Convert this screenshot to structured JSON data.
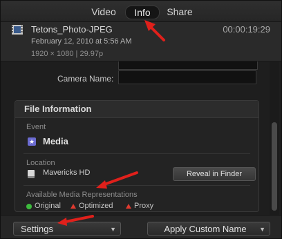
{
  "tabs": {
    "video": "Video",
    "info": "Info",
    "share": "Share"
  },
  "clip": {
    "name": "Tetons_Photo-JPEG",
    "duration": "00:00:19:29",
    "date": "February 12, 2010 at 5:56 AM",
    "format": "1920 × 1080  |  29.97p"
  },
  "metadata": {
    "camera_name_label": "Camera Name:",
    "camera_name_value": ""
  },
  "file_info": {
    "title": "File Information",
    "event_label": "Event",
    "event_value": "Media",
    "location_label": "Location",
    "location_value": "Mavericks HD",
    "reveal_button": "Reveal in Finder",
    "reps_label": "Available Media Representations",
    "reps": [
      "Original",
      "Optimized",
      "Proxy"
    ],
    "rep_colors": {
      "original": "#3dbb3d",
      "optimized": "#e03a2f",
      "proxy": "#e03a2f"
    }
  },
  "footer": {
    "settings_label": "Settings",
    "apply_label": "Apply Custom Name"
  },
  "annotation_color": "#e0201b"
}
